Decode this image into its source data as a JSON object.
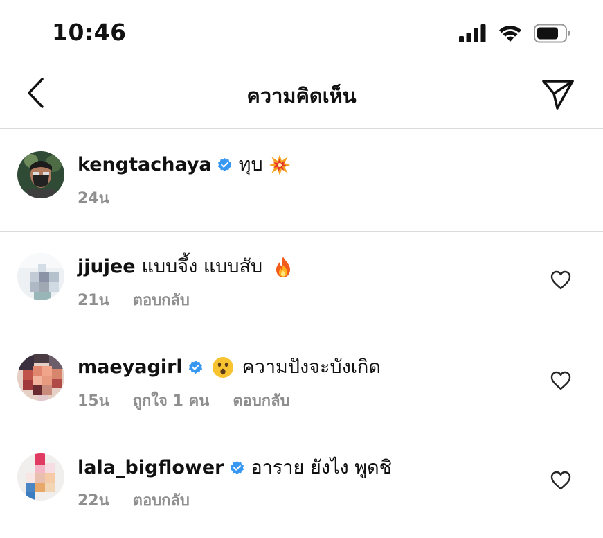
{
  "status_bar": {
    "time": "10:46",
    "icons": [
      "cellular-signal-icon",
      "wifi-icon",
      "battery-icon"
    ]
  },
  "header": {
    "title": "ความคิดเห็น",
    "back_icon": "chevron-left-icon",
    "share_icon": "paper-plane-icon"
  },
  "caption": {
    "username": "kengtachaya",
    "verified": true,
    "text": "ทุบ",
    "emoji": "collision-emoji",
    "time": "24น"
  },
  "comments": [
    {
      "username": "jjujee",
      "verified": false,
      "text": "แบบจึ้ง แบบสับ",
      "emoji": "fire-emoji",
      "time": "21น",
      "reply_label": "ตอบกลับ"
    },
    {
      "username": "maeyagirl",
      "verified": true,
      "emoji": "astonished-face-emoji",
      "text": "ความปังจะบังเกิด",
      "time": "15น",
      "likes_label": "ถูกใจ 1 คน",
      "reply_label": "ตอบกลับ"
    },
    {
      "username": "lala_bigflower",
      "verified": true,
      "text": "อาราย ยังไง พูดชิ",
      "time": "22น",
      "reply_label": "ตอบกลับ"
    }
  ],
  "colors": {
    "text_primary": "#111111",
    "text_secondary": "#8e8e8e",
    "divider": "#dbdbdb",
    "verified_blue": "#3897f0"
  }
}
